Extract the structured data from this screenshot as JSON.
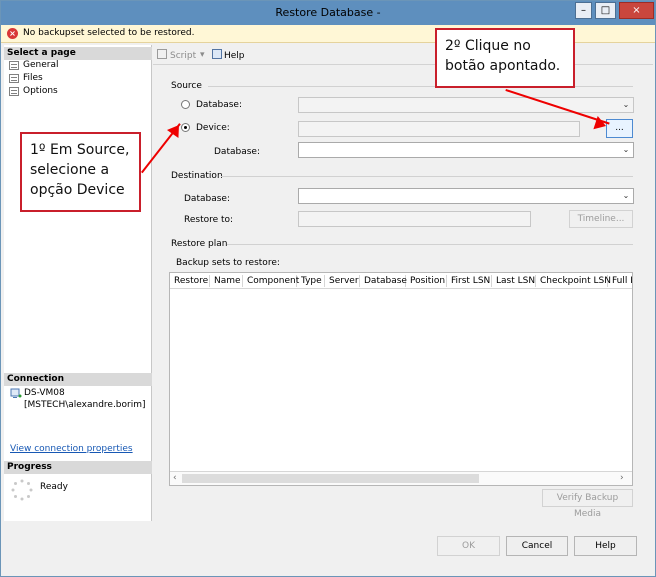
{
  "window": {
    "title": "Restore Database -"
  },
  "warning": {
    "text": "No backupset selected to be restored."
  },
  "left": {
    "select_page_heading": "Select a page",
    "items": [
      {
        "label": "General"
      },
      {
        "label": "Files"
      },
      {
        "label": "Options"
      }
    ],
    "connection_heading": "Connection",
    "server": "DS-VM08",
    "user": "[MSTECH\\alexandre.borim]",
    "view_link": "View connection properties",
    "progress_heading": "Progress",
    "progress_status": "Ready"
  },
  "toolbar": {
    "script_label": "Script",
    "help_label": "Help"
  },
  "source": {
    "heading": "Source",
    "database_label": "Database:",
    "device_label": "Device:",
    "device_db_label": "Database:",
    "browse_label": "...",
    "selected_option": "Device"
  },
  "destination": {
    "heading": "Destination",
    "database_label": "Database:",
    "restore_to_label": "Restore to:",
    "timeline_label": "Timeline..."
  },
  "restore_plan": {
    "heading": "Restore plan",
    "backup_sets_label": "Backup sets to restore:",
    "columns": [
      "Restore",
      "Name",
      "Component",
      "Type",
      "Server",
      "Database",
      "Position",
      "First LSN",
      "Last LSN",
      "Checkpoint LSN",
      "Full LS"
    ],
    "verify_label": "Verify Backup Media"
  },
  "buttons": {
    "ok": "OK",
    "cancel": "Cancel",
    "help": "Help"
  },
  "callouts": {
    "step1": "1º Em Source, selecione a opção Device",
    "step2": "2º Clique no botão apontado."
  },
  "colors": {
    "accent": "#5e8fbe",
    "annotation": "#c91f2b"
  }
}
